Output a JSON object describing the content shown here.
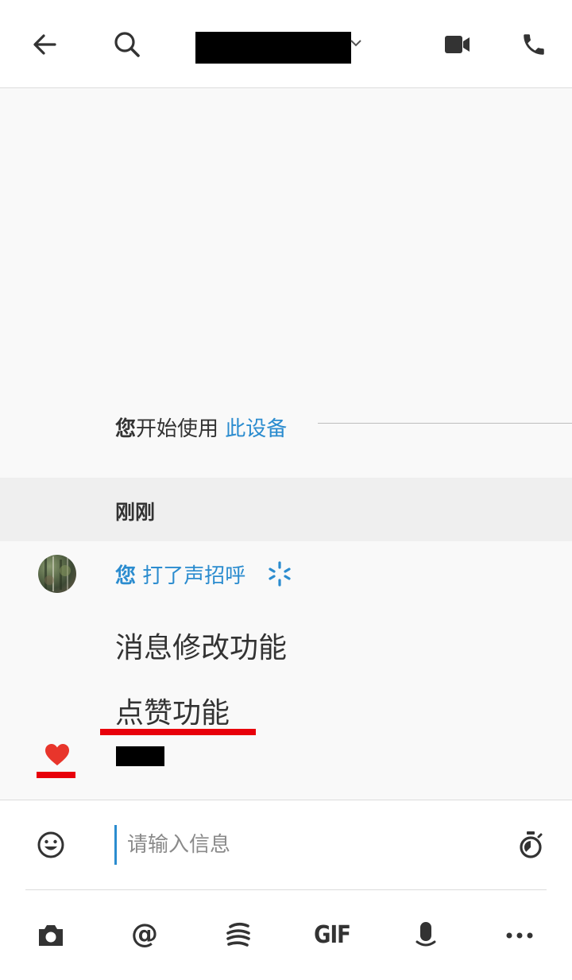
{
  "header": {
    "back_icon": "back-arrow-icon",
    "search_icon": "search-icon",
    "title_chevron_icon": "chevron-down-icon",
    "video_icon": "video-camera-icon",
    "call_icon": "phone-icon"
  },
  "conversation": {
    "divider": {
      "subject": "您",
      "action": "开始使用",
      "link": "此设备"
    },
    "time_label": "刚刚",
    "greeting": {
      "subject": "您",
      "action": "打了声招呼",
      "icon": "sparkle-icon"
    },
    "messages": [
      {
        "text": "消息修改功能"
      },
      {
        "text": "点赞功能"
      }
    ],
    "reaction_icon": "heart-icon",
    "colors": {
      "accent": "#2b8ccf",
      "highlight": "#e8000b",
      "heart": "#e8352b"
    }
  },
  "composer": {
    "placeholder": "请输入信息",
    "emoji_icon": "emoji-icon",
    "timer_icon": "timer-icon"
  },
  "toolbar": {
    "camera_icon": "camera-icon",
    "mention_label": "@",
    "sketch_icon": "sketch-icon",
    "gif_label": "GIF",
    "mic_icon": "microphone-icon",
    "more_icon": "more-icon"
  }
}
